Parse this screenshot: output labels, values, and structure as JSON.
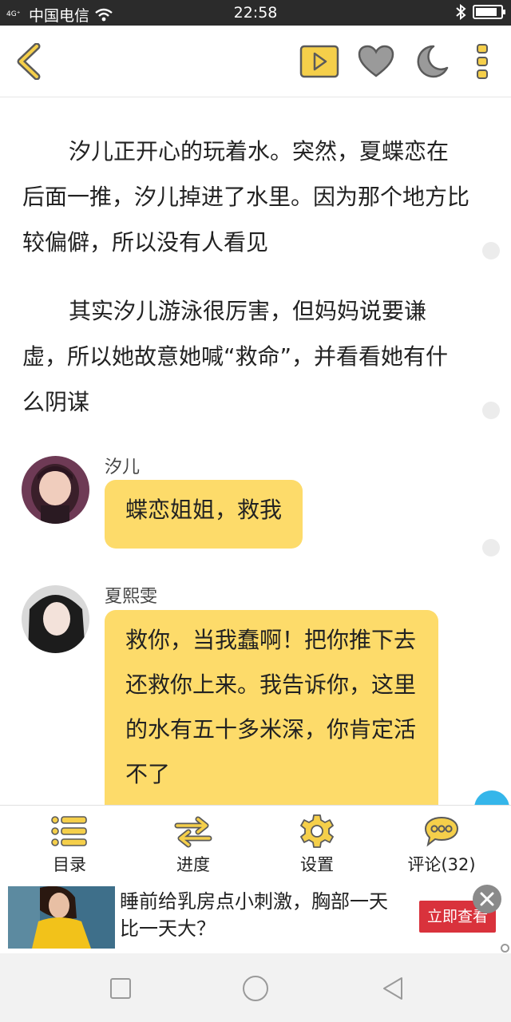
{
  "status_bar": {
    "signal_label": "4G⁺",
    "carrier": "中国电信",
    "time": "22:58",
    "battery_level": 0.85
  },
  "toolbar": {
    "back_icon": "chevron-left-icon",
    "play_icon": "play-icon",
    "favorite_icon": "heart-icon",
    "night_icon": "moon-icon",
    "more_icon": "more-vertical-icon",
    "accent_color": "#f5cf4a"
  },
  "story": {
    "paragraphs": [
      "汐儿正开心的玩着水。突然，夏蝶恋在后面一推，汐儿掉进了水里。因为那个地方比较偏僻，所以没有人看见",
      "其实汐儿游泳很厉害，但妈妈说要谦虚，所以她故意她喊“救命”，并看看她有什么阴谋"
    ],
    "messages": [
      {
        "name": "汐儿",
        "text": "蝶恋姐姐，救我"
      },
      {
        "name": "夏熙雯",
        "text": "救你，当我蠢啊！把你推下去还救你上来。我告诉你，这里的水有五十多米深，你肯定活不了"
      }
    ],
    "bubble_color": "#fddb6a"
  },
  "menu": {
    "items": [
      {
        "label": "目录",
        "icon": "list-icon"
      },
      {
        "label": "进度",
        "icon": "swap-arrows-icon"
      },
      {
        "label": "设置",
        "icon": "gear-icon"
      },
      {
        "label": "评论(32)",
        "icon": "comment-bubble-icon"
      }
    ]
  },
  "ad": {
    "text": "睡前给乳房点小刺激，胸部一天比一天大？",
    "button_label": "立即查看",
    "button_color": "#d9323c"
  },
  "nav": {
    "recent_icon": "square-icon",
    "home_icon": "circle-icon",
    "back_icon": "triangle-back-icon"
  }
}
